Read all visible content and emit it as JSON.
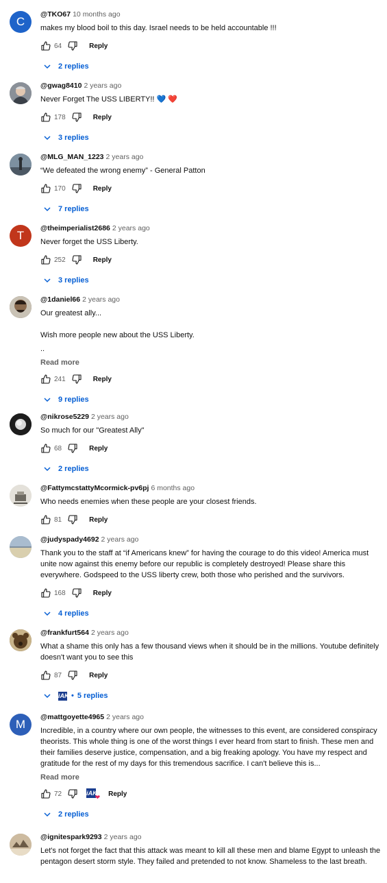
{
  "comments": [
    {
      "author": "@TKO67",
      "time": "10 months ago",
      "avatar_letter": "C",
      "avatar_color": "#1e63c9",
      "text": [
        "makes my blood boil to this day. Israel needs to be held accountable !!!"
      ],
      "likes": "64",
      "reply_label": "Reply",
      "replies": "2 replies"
    },
    {
      "author": "@gwag8410",
      "time": "2 years ago",
      "avatar_letter": "",
      "avatar_color": "#7a7f86",
      "text": [
        "Never Forget The USS LIBERTY!! 💙 ❤️"
      ],
      "likes": "178",
      "reply_label": "Reply",
      "replies": "3 replies"
    },
    {
      "author": "@MLG_MAN_1223",
      "time": "2 years ago",
      "avatar_letter": "",
      "avatar_color": "#5a6e7e",
      "text": [
        "“We defeated the wrong enemy” - General Patton"
      ],
      "likes": "170",
      "reply_label": "Reply",
      "replies": "7 replies"
    },
    {
      "author": "@theimperialist2686",
      "time": "2 years ago",
      "avatar_letter": "T",
      "avatar_color": "#c1361b",
      "text": [
        "Never forget the USS Liberty."
      ],
      "likes": "252",
      "reply_label": "Reply",
      "replies": "3 replies"
    },
    {
      "author": "@1daniel66",
      "time": "2 years ago",
      "avatar_letter": "",
      "avatar_color": "#6b5a4a",
      "text": [
        "Our greatest ally...",
        "Wish more people new about the USS Liberty.",
        ".."
      ],
      "read_more": "Read more",
      "likes": "241",
      "reply_label": "Reply",
      "replies": "9 replies"
    },
    {
      "author": "@nikrose5229",
      "time": "2 years ago",
      "avatar_letter": "",
      "avatar_color": "#1d1d1d",
      "text": [
        "So much for our \"Greatest Ally\""
      ],
      "likes": "68",
      "reply_label": "Reply",
      "replies": "2 replies"
    },
    {
      "author": "@FattymcstattyMcormick-pv6pj",
      "time": "6 months ago",
      "avatar_letter": "",
      "avatar_color": "#d9d6cf",
      "text": [
        "Who needs enemies when these people are your closest friends."
      ],
      "likes": "81",
      "reply_label": "Reply"
    },
    {
      "author": "@judyspady4692",
      "time": "2 years ago",
      "avatar_letter": "",
      "avatar_color": "#8fa3b8",
      "text": [
        "Thank you to the staff at “if Americans knew” for having the courage to do this video! America must unite now against this enemy before our republic is completely destroyed! Please share this everywhere. Godspeed to the USS liberty crew, both those who perished and the survivors."
      ],
      "likes": "168",
      "reply_label": "Reply",
      "replies": "4 replies"
    },
    {
      "author": "@frankfurt564",
      "time": "2 years ago",
      "avatar_letter": "",
      "avatar_color": "#5e4a30",
      "text": [
        "What a shame this only has a few thousand views when it should be in the millions. Youtube definitely doesn't want you to see this"
      ],
      "likes": "87",
      "reply_label": "Reply",
      "replies": "5 replies",
      "creator_replied": true
    },
    {
      "author": "@mattgoyette4965",
      "time": "2 years ago",
      "avatar_letter": "M",
      "avatar_color": "#2d5fb8",
      "text": [
        "Incredible, in a country where our own people, the witnesses to this event, are considered conspiracy theorists. This whole thing is one of the worst things I ever heard from start to finish. These men and their families deserve justice, compensation, and a big freaking apology. You have my respect and gratitude for the rest of my days for this tremendous sacrifice. I can't believe this is..."
      ],
      "read_more": "Read more",
      "likes": "72",
      "reply_label": "Reply",
      "replies": "2 replies",
      "creator_heart": true
    },
    {
      "author": "@ignitespark9293",
      "time": "2 years ago",
      "avatar_letter": "",
      "avatar_color": "#b9a58c",
      "text": [
        "Let's not forget the fact that this attack was meant to kill all these men and blame Egypt to unleash the pentagon desert storm style.  They failed and pretended to not know. Shameless to the last breath."
      ]
    }
  ],
  "creator_badge": "iAK",
  "heart_glyph": "❤"
}
